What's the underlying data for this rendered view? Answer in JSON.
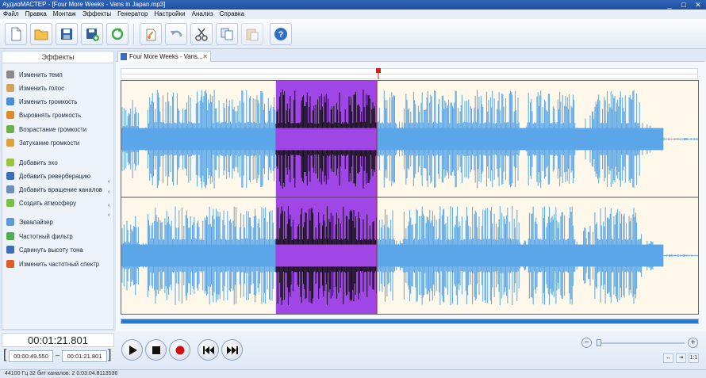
{
  "app": {
    "title": "АудиоМАСТЕР - [Four More Weeks - Vans in Japan.mp3]",
    "window_controls": [
      "_",
      "□",
      "✕"
    ]
  },
  "menu": [
    "Файл",
    "Правка",
    "Монтаж",
    "Эффекты",
    "Генератор",
    "Настройки",
    "Анализ",
    "Справка"
  ],
  "toolbar": {
    "buttons": [
      "new-file",
      "open-folder",
      "save",
      "save-as",
      "refresh",
      "audio-effect",
      "undo",
      "cut",
      "copy",
      "paste",
      "help"
    ]
  },
  "effects_panel": {
    "title": "Эффекты",
    "items": [
      {
        "label": "Изменить темп",
        "icon": "metronome-icon",
        "color": "#8a8a8a"
      },
      {
        "label": "Изменить голос",
        "icon": "voice-icon",
        "color": "#d4a35a"
      },
      {
        "label": "Изменить громкость",
        "icon": "volume-icon",
        "color": "#4a8fd6"
      },
      {
        "label": "Выровнять громкость",
        "icon": "equalize-volume-icon",
        "color": "#e08a2a"
      },
      {
        "label": "Возрастание громкости",
        "icon": "fade-in-icon",
        "color": "#6ab04c"
      },
      {
        "label": "Затухание громкости",
        "icon": "fade-out-icon",
        "color": "#e0a03a"
      },
      {
        "label": "Добавить эхо",
        "icon": "echo-icon",
        "color": "#9bc53d"
      },
      {
        "label": "Добавить реверберацию",
        "icon": "reverb-icon",
        "color": "#3c6fb5"
      },
      {
        "label": "Добавить вращение каналов",
        "icon": "channel-rotation-icon",
        "color": "#6d8fb8"
      },
      {
        "label": "Создать атмосферу",
        "icon": "atmosphere-icon",
        "color": "#7bc043"
      },
      {
        "label": "Эквалайзер",
        "icon": "equalizer-icon",
        "color": "#5b9bd5"
      },
      {
        "label": "Частотный фильтр",
        "icon": "filter-icon",
        "color": "#4caf50"
      },
      {
        "label": "Сдвинуть высоту тона",
        "icon": "pitch-icon",
        "color": "#3c6fb5"
      },
      {
        "label": "Изменить частотный спектр",
        "icon": "spectrum-icon",
        "color": "#e05a2a"
      }
    ]
  },
  "tab": {
    "label": "Four More Weeks - Vans..."
  },
  "waveform": {
    "selection_start_fraction": 0.268,
    "selection_end_fraction": 0.443,
    "playhead_fraction": 0.443,
    "colors": {
      "wave": "#5aa6e8",
      "background": "#fdf8ea",
      "selection": "#a045e6",
      "selection_wave": "#111111"
    }
  },
  "transport": {
    "current_time": "00:01:21.801",
    "selection_start": "00:00:49.550",
    "selection_separator": "–",
    "selection_end": "00:01:21.801"
  },
  "status": {
    "text": "44100 Гц  32 бит  каналов: 2    0:03:04.8113536"
  }
}
